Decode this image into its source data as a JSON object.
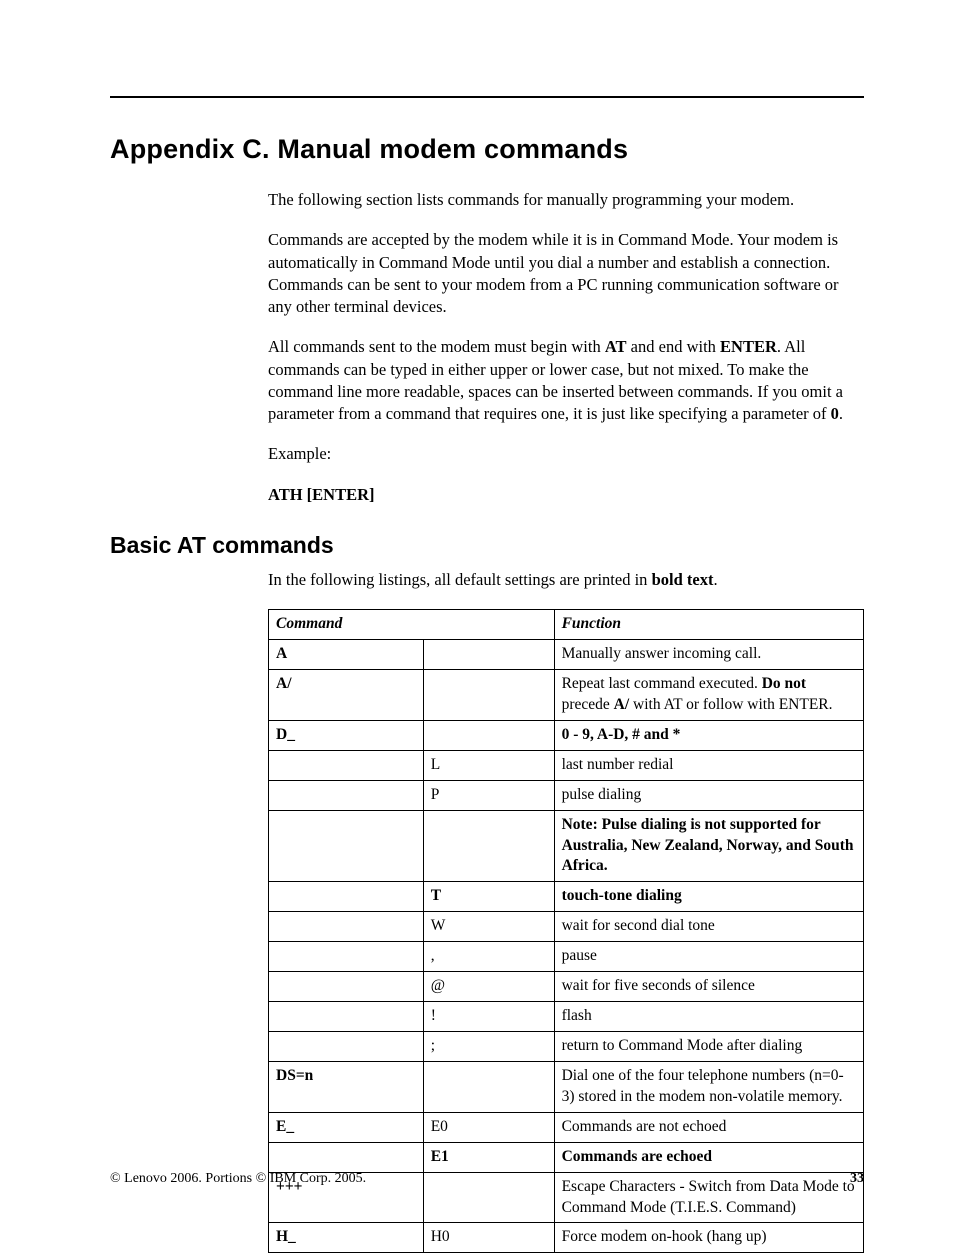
{
  "title": "Appendix C. Manual modem commands",
  "intro": {
    "p1": "The following section lists commands for manually programming your modem.",
    "p2": "Commands are accepted by the modem while it is in Command Mode. Your modem is automatically in Command Mode until you dial a number and establish a connection. Commands can be sent to your modem from a PC running communication software or any other terminal devices.",
    "p3_a": "All commands sent to the modem must begin with ",
    "p3_b": "AT",
    "p3_c": " and end with ",
    "p3_d": "ENTER",
    "p3_e": ". All commands can be typed in either upper or lower case, but not mixed. To make the command line more readable, spaces can be inserted between commands. If you omit a parameter from a command that requires one, it is just like specifying a parameter of ",
    "p3_f": "0",
    "p3_g": ".",
    "p4": "Example:",
    "p5": "ATH [ENTER]"
  },
  "section2": {
    "heading": "Basic AT commands",
    "lead_a": "In the following listings, all default settings are printed in ",
    "lead_b": "bold text",
    "lead_c": "."
  },
  "table": {
    "h1": "Command",
    "h2": "",
    "h3": "Function",
    "rows": [
      {
        "c1_b": "A",
        "c2": "",
        "c3": "Manually answer incoming call."
      },
      {
        "c1_b": "A/",
        "c2": "",
        "c3_a": "Repeat last command executed. ",
        "c3_b": "Do not",
        "c3_c": " precede ",
        "c3_d": "A/",
        "c3_e": " with AT or follow with ENTER."
      },
      {
        "c1_b": "D_",
        "c2": "",
        "c3_b": "0 - 9, A-D, # and *"
      },
      {
        "c1": "",
        "c2": "L",
        "c3": "last number redial"
      },
      {
        "c1": "",
        "c2": "P",
        "c3": "pulse dialing"
      },
      {
        "c1": "",
        "c2": "",
        "c3_b": "Note: Pulse dialing is not supported for Australia, New Zealand, Norway, and South Africa."
      },
      {
        "c1": "",
        "c2_b": "T",
        "c3_b": "touch-tone dialing"
      },
      {
        "c1": "",
        "c2": "W",
        "c3": "wait for second dial tone"
      },
      {
        "c1": "",
        "c2": ",",
        "c3": "pause"
      },
      {
        "c1": "",
        "c2": "@",
        "c3": "wait for five seconds of silence"
      },
      {
        "c1": "",
        "c2": "!",
        "c3": "flash"
      },
      {
        "c1": "",
        "c2": ";",
        "c3": "return to Command Mode after dialing"
      },
      {
        "c1_b": "DS=n",
        "c2": "",
        "c3": "Dial one of the four telephone numbers (n=0-3) stored in the modem non-volatile memory."
      },
      {
        "c1_b": "E_",
        "c2": "E0",
        "c3": "Commands are not echoed"
      },
      {
        "c1": "",
        "c2_b": "E1",
        "c3_b": "Commands are echoed"
      },
      {
        "c1_b": "+++",
        "c2": "",
        "c3": "Escape Characters - Switch from Data Mode to Command Mode (T.I.E.S. Command)"
      },
      {
        "c1_b": "H_",
        "c2": "H0",
        "c3": "Force modem on-hook (hang up)"
      }
    ]
  },
  "footer": {
    "copyright": "© Lenovo 2006. Portions © IBM Corp. 2005.",
    "page": "33"
  }
}
